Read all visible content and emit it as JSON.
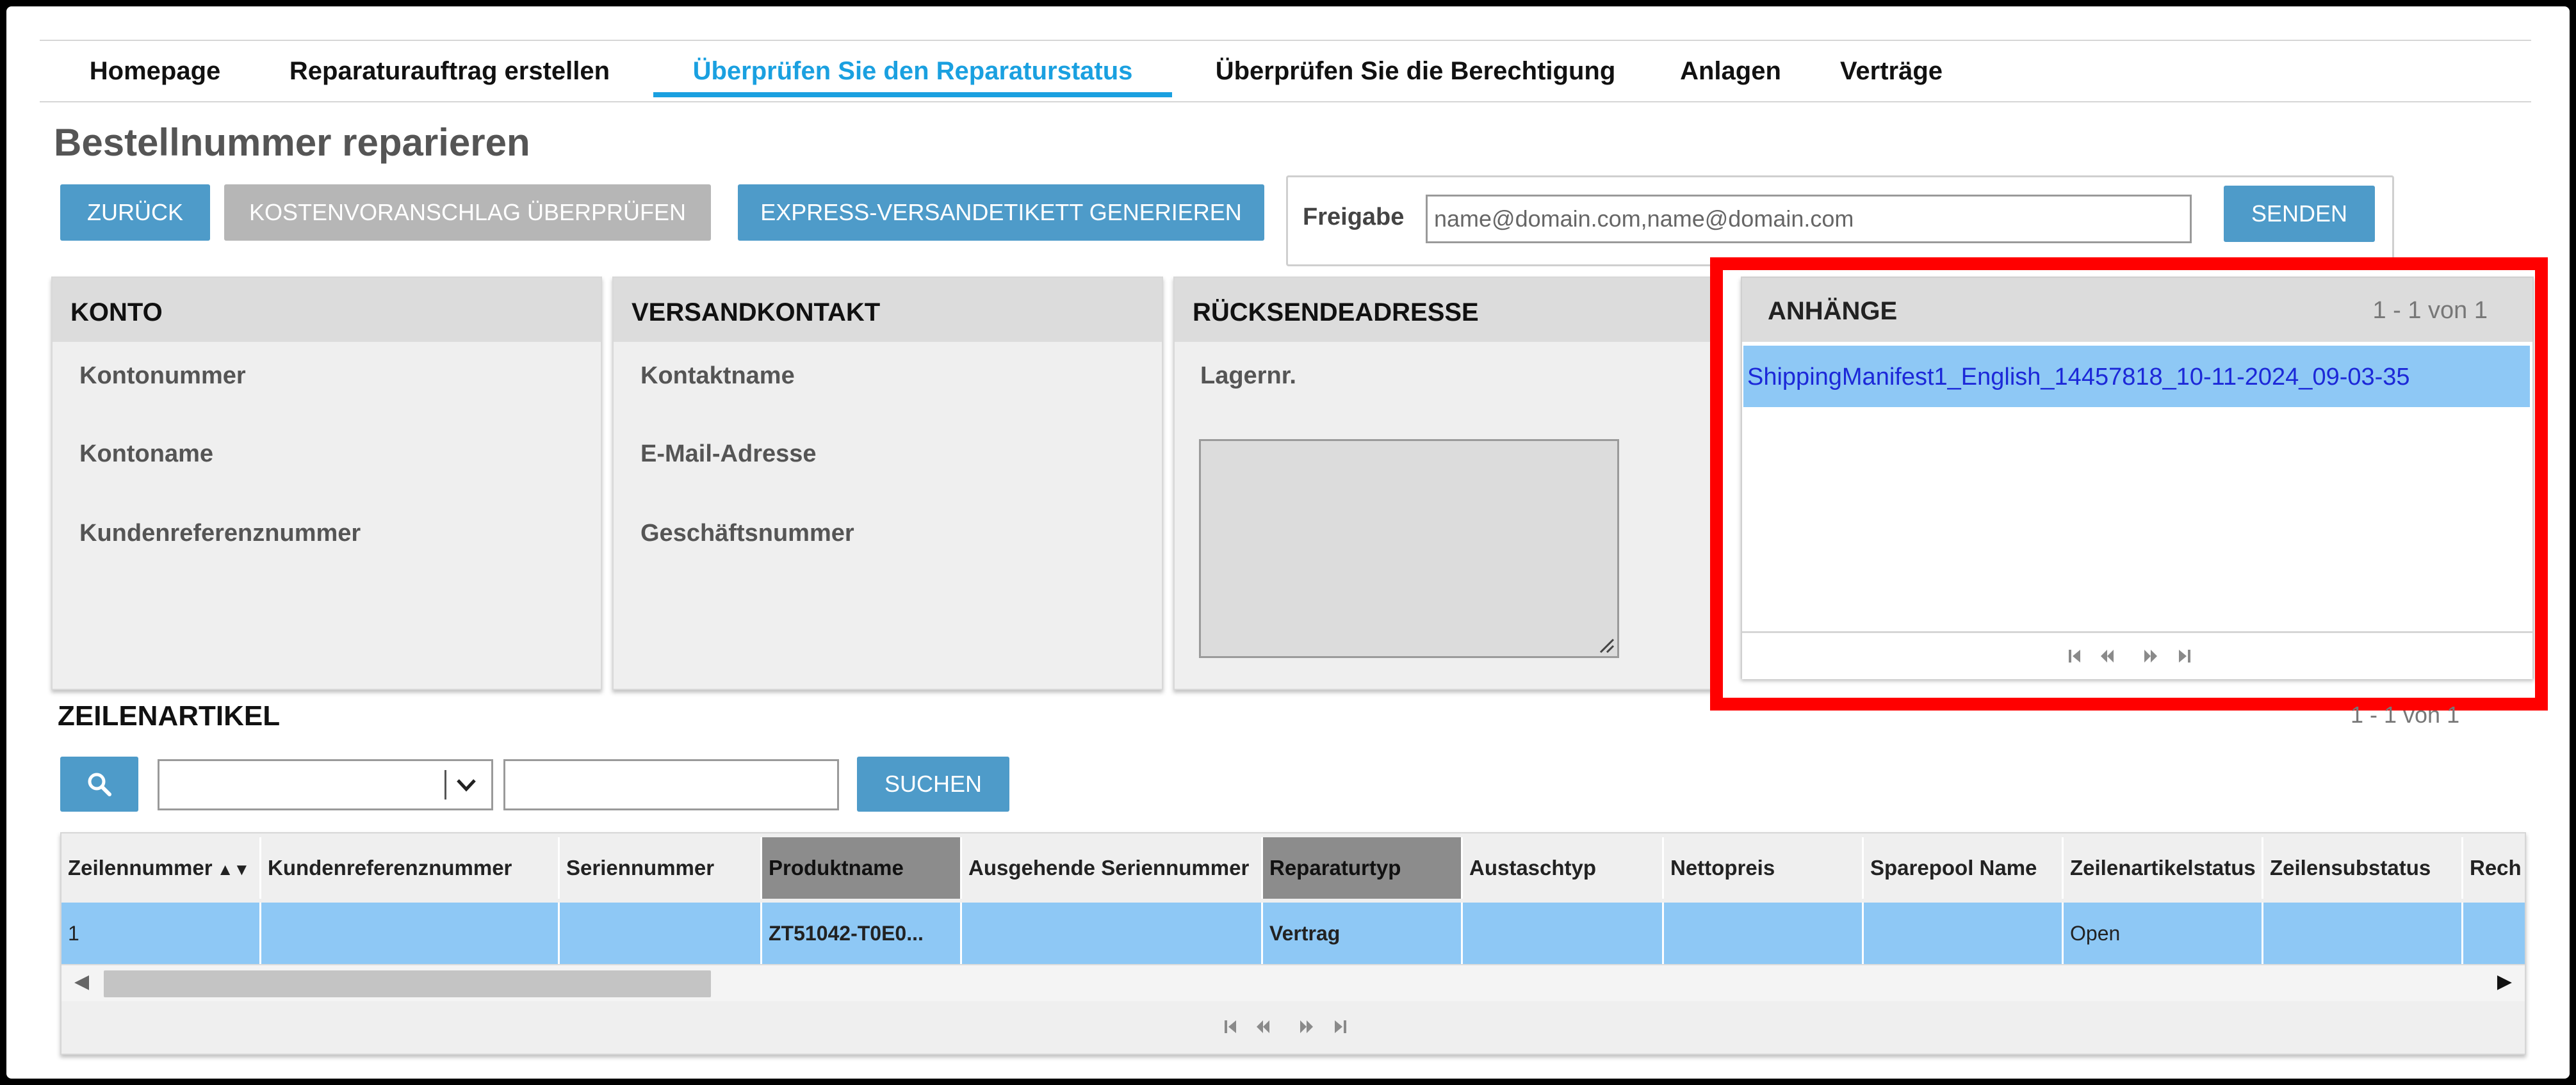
{
  "nav": {
    "tabs": [
      {
        "label": "Homepage"
      },
      {
        "label": "Reparaturauftrag erstellen"
      },
      {
        "label": "Überprüfen Sie den Reparaturstatus"
      },
      {
        "label": "Überprüfen Sie die Berechtigung"
      },
      {
        "label": "Anlagen"
      },
      {
        "label": "Verträge"
      }
    ],
    "active_index": 2,
    "accent_color": "#1aa0e0"
  },
  "page": {
    "title": "Bestellnummer reparieren"
  },
  "toolbar": {
    "back_label": "ZURÜCK",
    "estimate_label": "KOSTENVORANSCHLAG ÜBERPRÜFEN",
    "express_label": "EXPRESS-VERSANDETIKETT GENERIEREN",
    "share_label": "Freigabe",
    "share_placeholder": "name@domain.com,name@domain.com",
    "send_label": "SENDEN"
  },
  "panels": {
    "account": {
      "title": "KONTO",
      "fields": [
        "Kontonummer",
        "Kontoname",
        "Kundenreferenznummer"
      ]
    },
    "shipping_contact": {
      "title": "VERSANDKONTAKT",
      "fields": [
        "Kontaktname",
        "E-Mail-Adresse",
        "Geschäftsnummer"
      ]
    },
    "return_address": {
      "title": "RÜCKSENDEADRESSE",
      "fields": [
        "Lagernr."
      ]
    },
    "attachments": {
      "title": "ANHÄNGE",
      "count": "1 - 1 von 1",
      "items": [
        "ShippingManifest1_English_14457818_10-11-2024_09-03-35"
      ]
    }
  },
  "line_items": {
    "title": "ZEILENARTIKEL",
    "pager": "1 - 1 von 1",
    "search_label": "SUCHEN",
    "columns": [
      "Zeilennummer",
      "Kundenreferenznummer",
      "Seriennummer",
      "Produktname",
      "Ausgehende Seriennummer",
      "Reparaturtyp",
      "Austaschtyp",
      "Nettopreis",
      "Sparepool Name",
      "Zeilenartikelstatus",
      "Zeilensubstatus",
      "Rech"
    ],
    "rows": [
      [
        "1",
        "",
        "",
        "ZT51042-T0E0...",
        "",
        "Vertrag",
        "",
        "",
        "",
        "Open",
        "",
        ""
      ]
    ]
  },
  "highlight_color": "#ff0000"
}
